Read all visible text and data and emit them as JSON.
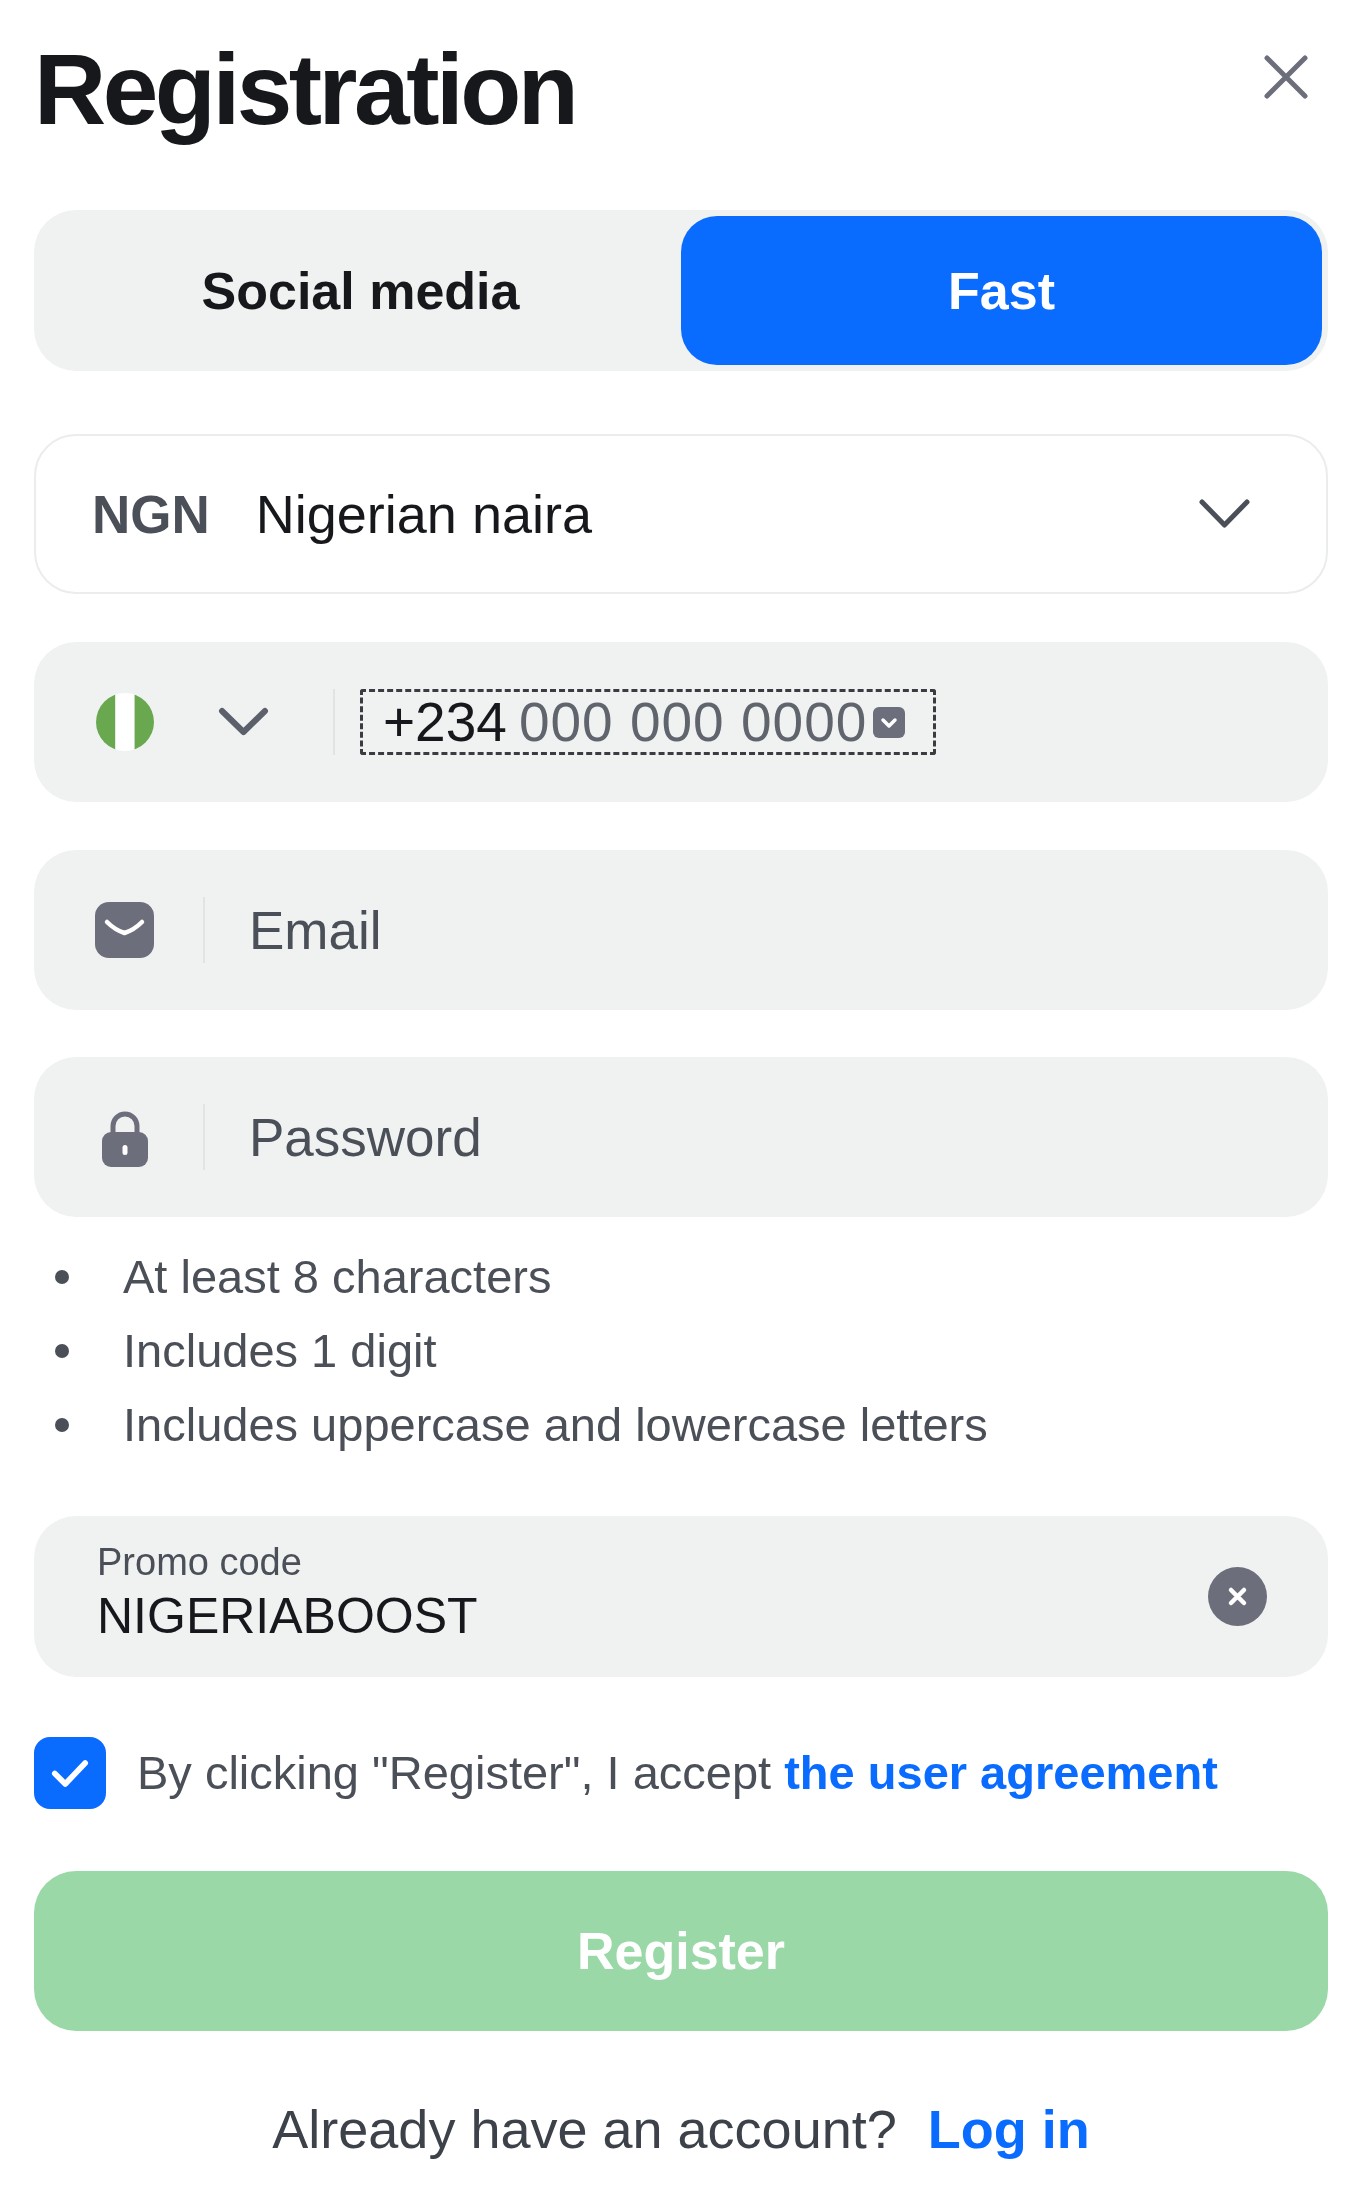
{
  "title": "Registration",
  "tabs": [
    {
      "label": "Social media",
      "selected": false
    },
    {
      "label": "Fast",
      "selected": true
    }
  ],
  "currency": {
    "code": "NGN",
    "name": "Nigerian naira"
  },
  "phone": {
    "prefix": "+234",
    "placeholder": "000 000 0000"
  },
  "email": {
    "placeholder": "Email"
  },
  "password": {
    "placeholder": "Password"
  },
  "password_rules": [
    "At least 8 characters",
    "Includes 1 digit",
    "Includes uppercase and lowercase letters"
  ],
  "promo_code": {
    "label": "Promo code",
    "value": "NIGERIABOOST"
  },
  "agreement": {
    "checked": true,
    "text": "By clicking \"Register\", I accept",
    "link": "the user agreement"
  },
  "register_button": {
    "label": "Register",
    "disabled": true
  },
  "login_prompt": {
    "text": "Already have an account?",
    "link": "Log in"
  }
}
